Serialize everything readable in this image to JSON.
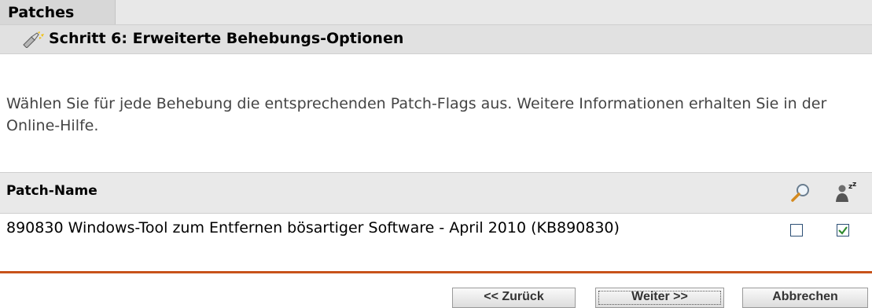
{
  "header": {
    "tab_label": "Patches",
    "step_title": "Schritt 6: Erweiterte Behebungs-Optionen"
  },
  "instructions": "Wählen Sie für jede Behebung die entsprechenden Patch-Flags aus. Weitere Informationen erhalten Sie in der Online-Hilfe.",
  "table": {
    "column_header": "Patch-Name",
    "header_icons": [
      "search-icon",
      "sleep-icon"
    ],
    "rows": [
      {
        "name": "890830 Windows-Tool zum Entfernen bösartiger Software - April 2010 (KB890830)",
        "flag1_checked": false,
        "flag2_checked": true
      }
    ]
  },
  "buttons": {
    "back": "<< Zurück",
    "next": "Weiter >>",
    "cancel": "Abbrechen"
  },
  "colors": {
    "accent_rule": "#c8531a",
    "checkbox_check": "#2e8b2e"
  }
}
